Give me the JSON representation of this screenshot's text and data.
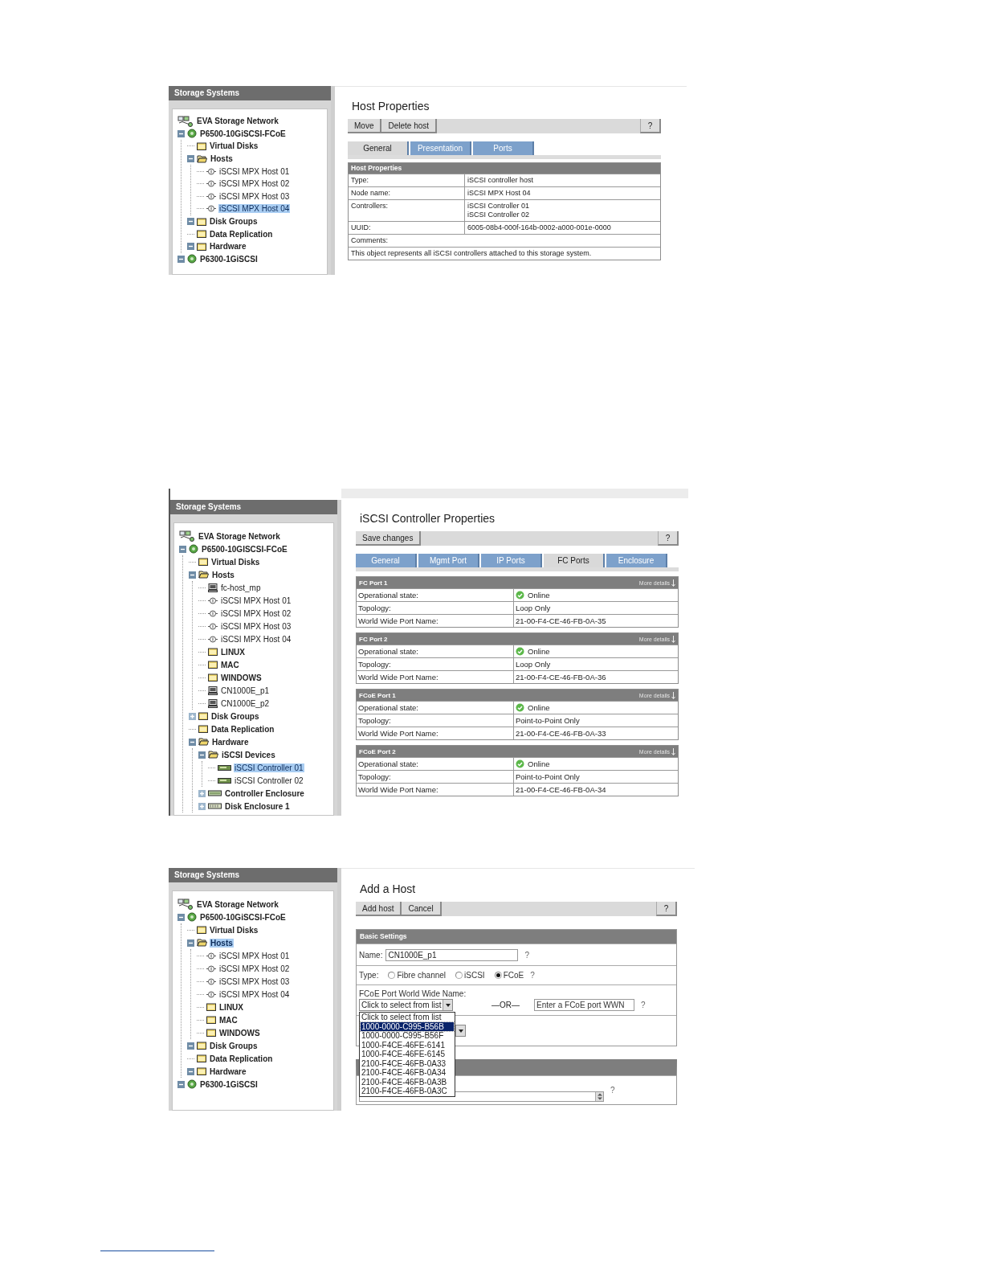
{
  "shots": [
    {
      "sidebar_title": "Storage Systems",
      "title": "Host Properties",
      "toolbar": [
        "Move",
        "Delete host"
      ],
      "help": "?",
      "tree": [
        {
          "label": "EVA Storage Network",
          "kind": "network",
          "selected": false
        },
        {
          "label": "P6500-10GiSCSI-FCoE",
          "kind": "system",
          "selected": false,
          "expanded": true,
          "children": [
            {
              "label": "Virtual Disks",
              "kind": "folder",
              "selected": false
            },
            {
              "label": "Hosts",
              "kind": "folder",
              "selected": false,
              "expanded": true,
              "children": [
                {
                  "label": "iSCSI MPX Host 01",
                  "kind": "iscsi-host",
                  "selected": false
                },
                {
                  "label": "iSCSI MPX Host 02",
                  "kind": "iscsi-host",
                  "selected": false
                },
                {
                  "label": "iSCSI MPX Host 03",
                  "kind": "iscsi-host",
                  "selected": false
                },
                {
                  "label": "iSCSI MPX Host 04",
                  "kind": "iscsi-host",
                  "selected": true
                }
              ]
            },
            {
              "label": "Disk Groups",
              "kind": "folder",
              "selected": false,
              "expanded": true
            },
            {
              "label": "Data Replication",
              "kind": "folder",
              "selected": false
            },
            {
              "label": "Hardware",
              "kind": "folder",
              "selected": false,
              "expanded": true
            }
          ]
        },
        {
          "label": "P6300-1GiSCSI",
          "kind": "system",
          "selected": false,
          "expanded": true
        }
      ],
      "tabs": [
        {
          "label": "General",
          "selected": true
        },
        {
          "label": "Presentation",
          "selected": false
        },
        {
          "label": "Ports",
          "selected": false
        }
      ],
      "content": {
        "kind": "properties",
        "table": {
          "title": "Host Properties",
          "rows": [
            {
              "kind": "pair",
              "label": "Type:",
              "lines": [
                "iSCSI controller host"
              ]
            },
            {
              "kind": "pair",
              "label": "Node name:",
              "lines": [
                "iSCSI MPX Host 04"
              ]
            },
            {
              "kind": "pair",
              "label": "Controllers:",
              "lines": [
                "iSCSI Controller 01",
                "iSCSI Controller 02"
              ]
            },
            {
              "kind": "pair",
              "label": "UUID:",
              "lines": [
                "6005-08b4-000f-164b-0002-a000-001e-0000"
              ]
            },
            {
              "kind": "full",
              "text": "Comments:"
            },
            {
              "kind": "full",
              "text": "This object represents all iSCSI controllers attached to this storage system."
            }
          ]
        }
      }
    },
    {
      "sidebar_title": "Storage Systems",
      "title": "iSCSI Controller Properties",
      "toolbar": [
        "Save changes"
      ],
      "help": "?",
      "tree": [
        {
          "label": "EVA Storage Network",
          "kind": "network",
          "selected": false
        },
        {
          "label": "P6500-10GISCSI-FCoE",
          "kind": "system",
          "selected": false,
          "expanded": true,
          "children": [
            {
              "label": "Virtual Disks",
              "kind": "folder",
              "selected": false
            },
            {
              "label": "Hosts",
              "kind": "folder",
              "selected": false,
              "expanded": true,
              "children": [
                {
                  "label": "fc-host_mp",
                  "kind": "fc-host",
                  "selected": false
                },
                {
                  "label": "iSCSI MPX Host 01",
                  "kind": "iscsi-host",
                  "selected": false
                },
                {
                  "label": "iSCSI MPX Host 02",
                  "kind": "iscsi-host",
                  "selected": false
                },
                {
                  "label": "iSCSI MPX Host 03",
                  "kind": "iscsi-host",
                  "selected": false
                },
                {
                  "label": "iSCSI MPX Host 04",
                  "kind": "iscsi-host",
                  "selected": false
                },
                {
                  "label": "LINUX",
                  "kind": "folder",
                  "selected": false
                },
                {
                  "label": "MAC",
                  "kind": "folder",
                  "selected": false
                },
                {
                  "label": "WINDOWS",
                  "kind": "folder",
                  "selected": false
                },
                {
                  "label": "CN1000E_p1",
                  "kind": "fc-host",
                  "selected": false
                },
                {
                  "label": "CN1000E_p2",
                  "kind": "fc-host",
                  "selected": false
                }
              ]
            },
            {
              "label": "Disk Groups",
              "kind": "folder",
              "selected": false,
              "expanded": false
            },
            {
              "label": "Data Replication",
              "kind": "folder",
              "selected": false
            },
            {
              "label": "Hardware",
              "kind": "folder",
              "selected": false,
              "expanded": true,
              "children": [
                {
                  "label": "iSCSI Devices",
                  "kind": "folder",
                  "selected": false,
                  "expanded": true,
                  "children": [
                    {
                      "label": "iSCSI Controller 01",
                      "kind": "controller",
                      "selected": true
                    },
                    {
                      "label": "iSCSI Controller 02",
                      "kind": "controller",
                      "selected": false
                    }
                  ]
                },
                {
                  "label": "Controller Enclosure",
                  "kind": "enclosure",
                  "selected": false,
                  "expanded": false
                },
                {
                  "label": "Disk Enclosure 1",
                  "kind": "disk-enclosure",
                  "selected": false,
                  "expanded": false
                }
              ]
            }
          ]
        }
      ],
      "tabs": [
        {
          "label": "General",
          "selected": false
        },
        {
          "label": "Mgmt Port",
          "selected": false
        },
        {
          "label": "IP Ports",
          "selected": false
        },
        {
          "label": "FC Ports",
          "selected": true
        },
        {
          "label": "Enclosure",
          "selected": false
        }
      ],
      "content": {
        "kind": "ports",
        "tables": [
          {
            "title": "FC Port 1",
            "more": "More details",
            "rows": [
              {
                "label": "Operational state:",
                "value": "Online",
                "ok": true
              },
              {
                "label": "Topology:",
                "value": "Loop Only"
              },
              {
                "label": "World Wide Port Name:",
                "value": "21-00-F4-CE-46-FB-0A-35"
              }
            ]
          },
          {
            "title": "FC Port 2",
            "more": "More details",
            "rows": [
              {
                "label": "Operational state:",
                "value": "Online",
                "ok": true
              },
              {
                "label": "Topology:",
                "value": "Loop Only"
              },
              {
                "label": "World Wide Port Name:",
                "value": "21-00-F4-CE-46-FB-0A-36"
              }
            ]
          },
          {
            "title": "FCoE Port 1",
            "more": "More details",
            "rows": [
              {
                "label": "Operational state:",
                "value": "Online",
                "ok": true
              },
              {
                "label": "Topology:",
                "value": "Point-to-Point Only"
              },
              {
                "label": "World Wide Port Name:",
                "value": "21-00-F4-CE-46-FB-0A-33"
              }
            ]
          },
          {
            "title": "FCoE Port 2",
            "more": "More details",
            "rows": [
              {
                "label": "Operational state:",
                "value": "Online",
                "ok": true
              },
              {
                "label": "Topology:",
                "value": "Point-to-Point Only"
              },
              {
                "label": "World Wide Port Name:",
                "value": "21-00-F4-CE-46-FB-0A-34"
              }
            ]
          }
        ]
      }
    },
    {
      "sidebar_title": "Storage Systems",
      "title": "Add a Host",
      "toolbar": [
        "Add host",
        "Cancel"
      ],
      "help": "?",
      "tree": [
        {
          "label": "EVA Storage Network",
          "kind": "network",
          "selected": false
        },
        {
          "label": "P6500-10GiSCSI-FCoE",
          "kind": "system",
          "selected": false,
          "expanded": true,
          "children": [
            {
              "label": "Virtual Disks",
              "kind": "folder",
              "selected": false
            },
            {
              "label": "Hosts",
              "kind": "folder",
              "selected": true,
              "expanded": true,
              "children": [
                {
                  "label": "iSCSI MPX Host 01",
                  "kind": "iscsi-host",
                  "selected": false
                },
                {
                  "label": "iSCSI MPX Host 02",
                  "kind": "iscsi-host",
                  "selected": false
                },
                {
                  "label": "iSCSI MPX Host 03",
                  "kind": "iscsi-host",
                  "selected": false
                },
                {
                  "label": "iSCSI MPX Host 04",
                  "kind": "iscsi-host",
                  "selected": false
                },
                {
                  "label": "LINUX",
                  "kind": "folder",
                  "selected": false
                },
                {
                  "label": "MAC",
                  "kind": "folder",
                  "selected": false
                },
                {
                  "label": "WINDOWS",
                  "kind": "folder",
                  "selected": false
                }
              ]
            },
            {
              "label": "Disk Groups",
              "kind": "folder",
              "selected": false,
              "expanded": true
            },
            {
              "label": "Data Replication",
              "kind": "folder",
              "selected": false
            },
            {
              "label": "Hardware",
              "kind": "folder",
              "selected": false,
              "expanded": true
            }
          ]
        },
        {
          "label": "P6300-1GiSCSI",
          "kind": "system",
          "selected": false,
          "expanded": true
        }
      ],
      "content": {
        "kind": "form",
        "section": "Basic Settings",
        "name": {
          "label": "Name:",
          "value": "CN1000E_p1",
          "help": "?"
        },
        "type": {
          "label": "Type:",
          "help": "?",
          "options": [
            {
              "label": "Fibre channel",
              "selected": false
            },
            {
              "label": "iSCSI",
              "selected": false
            },
            {
              "label": "FCoE",
              "selected": true
            }
          ]
        },
        "wwn": {
          "label": "FCoE Port World Wide Name:",
          "select": "Click to select from list",
          "or": "—OR—",
          "placeholder": "Enter a FCoE port WWN",
          "help": "?",
          "options": [
            {
              "label": "Click to select from list",
              "selected": false
            },
            {
              "label": "1000-0000-C995-B56B",
              "selected": true
            },
            {
              "label": "1000-0000-C995-B56F",
              "selected": false
            },
            {
              "label": "1000-F4CE-46FE-6141",
              "selected": false
            },
            {
              "label": "1000-F4CE-46FE-6145",
              "selected": false
            },
            {
              "label": "2100-F4CE-46FB-0A33",
              "selected": false
            },
            {
              "label": "2100-F4CE-46FB-0A34",
              "selected": false
            },
            {
              "label": "2100-F4CE-46FB-0A3B",
              "selected": false
            },
            {
              "label": "2100-F4CE-46FB-0A3C",
              "selected": false
            }
          ]
        },
        "comment_help": "?"
      }
    }
  ]
}
